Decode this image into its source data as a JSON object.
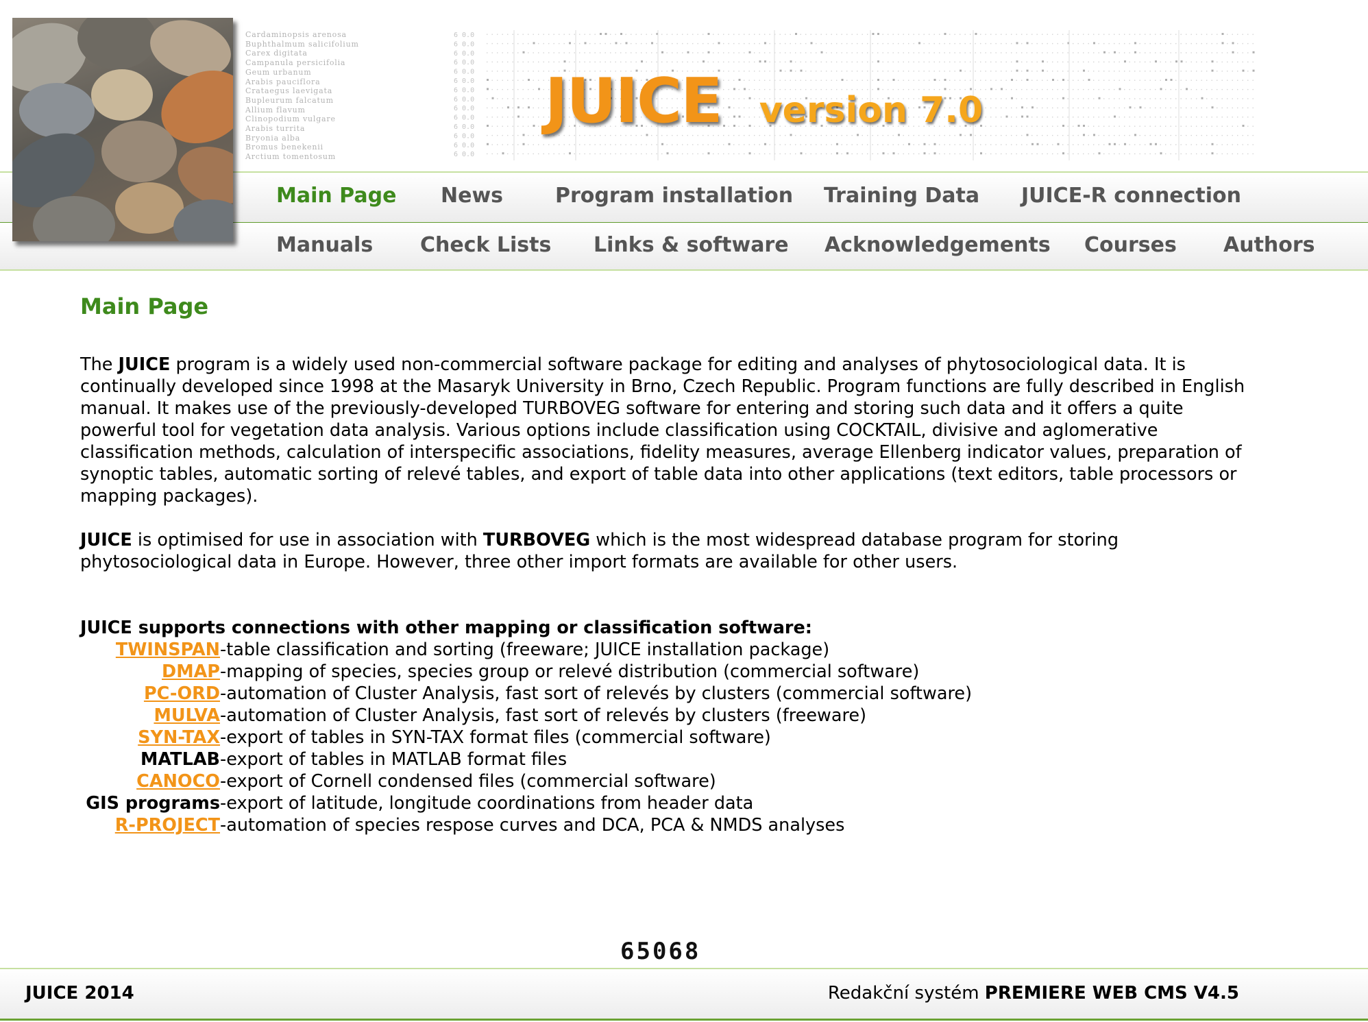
{
  "header": {
    "logo_title": "JUICE",
    "logo_version": "version 7.0",
    "species_list": [
      "Cardaminopsis arenosa",
      "Buphthalmum salicifolium",
      "Carex digitata",
      "Campanula persicifolia",
      "Geum urbanum",
      "Arabis pauciflora",
      "Crataegus laevigata",
      "Bupleurum falcatum",
      "Allium flavum",
      "Clinopodium vulgare",
      "Arabis turrita",
      "Bryonia alba",
      "Bromus benekenii",
      "Arctium tomentosum"
    ],
    "photo_icon": "pebbles-photo"
  },
  "nav": {
    "row1": [
      {
        "label": "Main Page",
        "active": true
      },
      {
        "label": "News"
      },
      {
        "label": "Program installation"
      },
      {
        "label": "Training Data"
      },
      {
        "label": "JUICE-R connection"
      }
    ],
    "row2": [
      {
        "label": "Manuals"
      },
      {
        "label": "Check Lists"
      },
      {
        "label": "Links & software"
      },
      {
        "label": "Acknowledgements"
      },
      {
        "label": "Courses"
      },
      {
        "label": "Authors"
      }
    ]
  },
  "main": {
    "heading": "Main Page",
    "p1": {
      "pre": "The ",
      "bold": "JUICE",
      "post": " program is a widely used non-commercial software package for editing and analyses of phytosociological data. It is continually developed since 1998 at the Masaryk University in Brno, Czech Republic. Program functions are fully described in English manual. It makes use of the previously-developed TURBOVEG software for entering and storing such data and it offers a quite powerful tool for vegetation data analysis. Various options include classification using COCKTAIL, divisive and aglomerative classification methods, calculation of interspecific associations, fidelity measures, average Ellenberg indicator values, preparation of synoptic tables, automatic sorting of relevé tables, and export of table data into other applications (text editors, table processors or mapping packages)."
    },
    "p2": {
      "bold1": "JUICE",
      "mid": " is optimised for use in association with ",
      "bold2": "TURBOVEG",
      "post": " which is the most widespread database program for storing phytosociological data in Europe. However, three other import formats are available for other users."
    },
    "connections_title": "JUICE supports connections with other mapping or classification software:",
    "connections": [
      {
        "name": "TWINSPAN",
        "link": true,
        "desc": "-table classification and sorting (freeware; JUICE installation package)"
      },
      {
        "name": "DMAP",
        "link": true,
        "desc": "-mapping of species, species group or relevé distribution (commercial software)"
      },
      {
        "name": "PC-ORD",
        "link": true,
        "desc": "-automation of Cluster Analysis, fast sort of relevés by clusters (commercial software)"
      },
      {
        "name": "MULVA",
        "link": true,
        "desc": "-automation of Cluster Analysis, fast sort of relevés by clusters (freeware)"
      },
      {
        "name": "SYN-TAX",
        "link": true,
        "desc": "-export of tables in SYN-TAX format files (commercial software)"
      },
      {
        "name": "MATLAB",
        "link": false,
        "desc": "-export of tables in MATLAB format files"
      },
      {
        "name": "CANOCO",
        "link": true,
        "desc": "-export of Cornell condensed files (commercial software)"
      },
      {
        "name": "GIS programs",
        "link": false,
        "desc": "-export of latitude, longitude coordinations from header data"
      },
      {
        "name": "R-PROJECT",
        "link": true,
        "desc": "-automation of species respose curves and DCA, PCA & NMDS analyses"
      }
    ]
  },
  "counter": "65068",
  "footer": {
    "left": "JUICE 2014",
    "right_pre": "Redakční systém ",
    "right_bold": "PREMIERE WEB CMS V4.5"
  },
  "colors": {
    "accent_green": "#3e8a1c",
    "link_orange": "#f29418",
    "nav_grey": "#555555"
  }
}
